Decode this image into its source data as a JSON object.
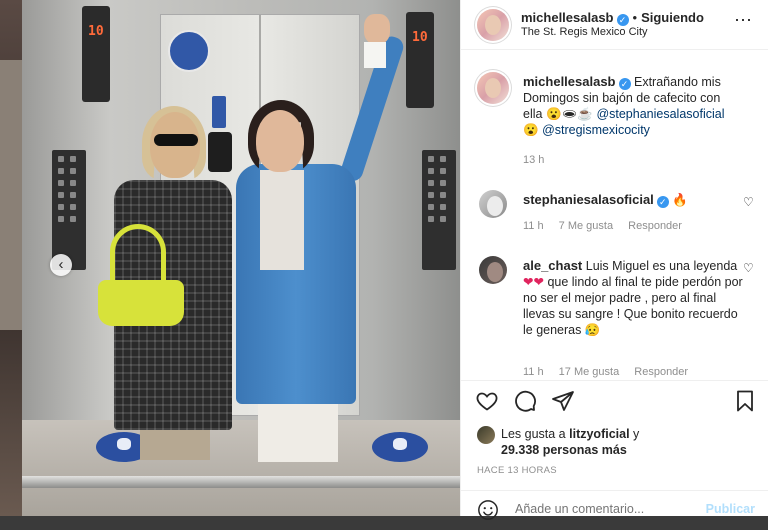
{
  "post": {
    "author": "michellesalasb",
    "follow_label": "Siguiendo",
    "location": "The St. Regis Mexico City",
    "caption_author": "michellesalasb",
    "caption_text": "Extrañando mis Domingos sin bajón de cafecito con ella",
    "caption_emojis": "😮🕳☕",
    "caption_mention_1": "@stephaniesalasoficial",
    "caption_emoji_2": "😮",
    "caption_mention_2": "@stregismexicocity",
    "caption_time": "13 h"
  },
  "photo": {
    "elevator_display_left": "10",
    "elevator_display_right": "10"
  },
  "comments": [
    {
      "author": "stephaniesalasoficial",
      "text": "🔥",
      "time": "11 h",
      "likes": "7 Me gusta",
      "reply_label": "Responder"
    },
    {
      "author": "ale_chast",
      "text_1": "Luis Miguel es una leyenda",
      "hearts": "❤❤",
      "text_2": "que lindo al final te pide perdón por no ser el mejor padre , pero al final llevas su sangre ! Que bonito recuerdo le generas",
      "emoji": "😥",
      "time": "11 h",
      "likes": "17 Me gusta",
      "reply_label": "Responder"
    }
  ],
  "likes": {
    "prefix": "Les gusta a",
    "user": "litzyoficial",
    "connector": "y",
    "count": "29.338 personas más"
  },
  "timeago": "HACE 13 HORAS",
  "add_comment": {
    "placeholder": "Añade un comentario...",
    "publish_label": "Publicar"
  },
  "icons": {
    "more": "⋯",
    "carousel_prev": "‹",
    "heart": "♡"
  },
  "colors": {
    "verified": "#3897f0",
    "mention": "#00376b",
    "publish_disabled": "#b2dffc"
  }
}
